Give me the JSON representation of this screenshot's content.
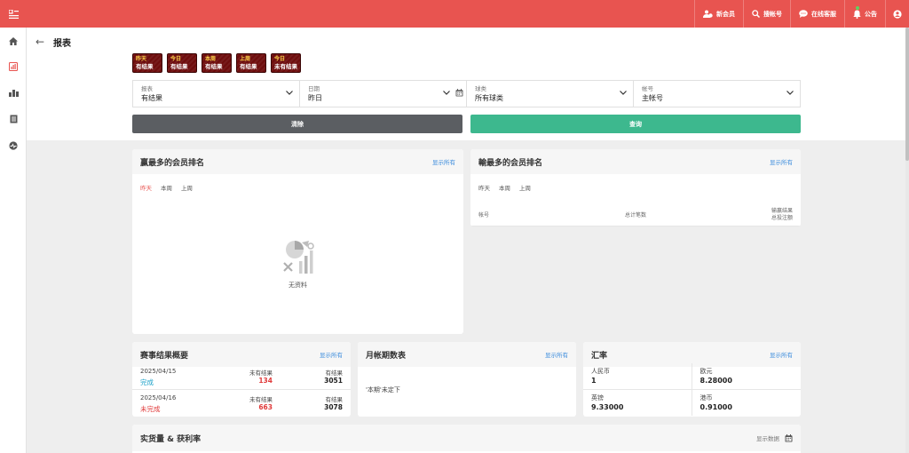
{
  "topbar": {
    "actions": [
      {
        "icon": "users-icon",
        "label": "新会员"
      },
      {
        "icon": "search-icon",
        "label": "搜帐号"
      },
      {
        "icon": "chat-icon",
        "label": "在线客服"
      },
      {
        "icon": "bell-icon",
        "label": "公告"
      },
      {
        "icon": "account-icon",
        "label": ""
      }
    ]
  },
  "sidebar": [
    "home-icon",
    "report-icon",
    "chart-bar-icon",
    "document-icon",
    "speedometer-icon"
  ],
  "report": {
    "title": "报表",
    "quick": [
      {
        "top": "昨天",
        "bottom": "有结果"
      },
      {
        "top": "今日",
        "bottom": "有结果"
      },
      {
        "top": "本周",
        "bottom": "有结果"
      },
      {
        "top": "上周",
        "bottom": "有结果"
      },
      {
        "top": "今日",
        "bottom": "未有结果"
      }
    ],
    "filters": [
      {
        "label": "报表",
        "value": "有结果"
      },
      {
        "label": "日期",
        "value": "昨日"
      },
      {
        "label": "球类",
        "value": "所有球类"
      },
      {
        "label": "帐号",
        "value": "主帐号"
      }
    ],
    "clear_label": "清除",
    "query_label": "查询"
  },
  "winners": {
    "title": "赢最多的会员排名",
    "show_all": "显示所有",
    "tabs": [
      "昨天",
      "本周",
      "上周"
    ],
    "empty": "无资料"
  },
  "losers": {
    "title": "輸最多的会员排名",
    "show_all": "显示所有",
    "tabs": [
      "昨天",
      "本周",
      "上周"
    ],
    "col_account": "帐号",
    "col_total": "总计笔数",
    "col_result_1": "输赢结果",
    "col_result_2": "总投注额"
  },
  "results": {
    "title": "赛事结果概要",
    "show_all": "显示所有",
    "rows": [
      {
        "date": "2025/04/15",
        "status": "完成",
        "unsettled_label": "未有结果",
        "unsettled": "134",
        "settled_label": "有结果",
        "settled": "3051"
      },
      {
        "date": "2025/04/16",
        "status": "未完成",
        "unsettled_label": "未有结果",
        "unsettled": "663",
        "settled_label": "有结果",
        "settled": "3078"
      }
    ],
    "colors": {
      "done": "#1aa0c8",
      "undone": "#e03a3a",
      "unsettled": "#e03a3a"
    }
  },
  "monthly": {
    "title": "月帐期数表",
    "show_all": "显示所有",
    "message": "'本期'未定下"
  },
  "fx": {
    "title": "汇率",
    "show_all": "显示所有",
    "rates": [
      {
        "name": "人民币",
        "value": "1"
      },
      {
        "name": "欧元",
        "value": "8.28000"
      },
      {
        "name": "英镑",
        "value": "9.33000"
      },
      {
        "name": "港币",
        "value": "0.91000"
      }
    ]
  },
  "turnover": {
    "title": "实货量 & 获利率",
    "show_data": "显示数据"
  },
  "colors": {
    "brand": "#e85450",
    "query": "#3db88e",
    "clear": "#5b5e62",
    "link": "#3a8bdc"
  }
}
